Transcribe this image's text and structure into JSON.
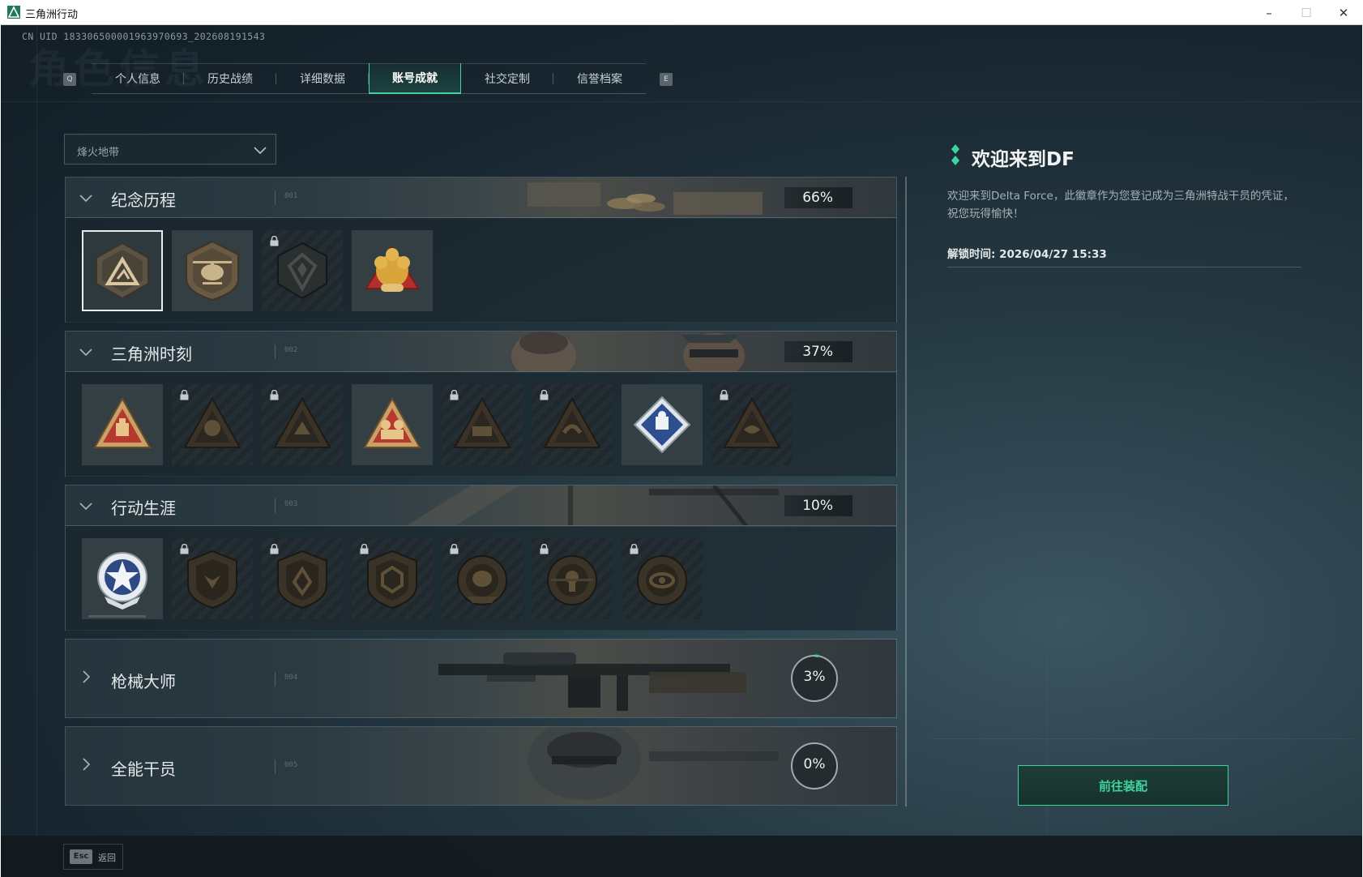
{
  "window": {
    "title": "三角洲行动",
    "minimize_label": "–",
    "maximize_label": "☐",
    "close_label": "✕"
  },
  "header": {
    "uid": "CN UID 183306500001963970693_202608191543",
    "bg_title": "角色信息"
  },
  "tabs": {
    "left_key": "Q",
    "right_key": "E",
    "items": [
      {
        "label": "个人信息",
        "active": false
      },
      {
        "label": "历史战绩",
        "active": false
      },
      {
        "label": "详细数据",
        "active": false
      },
      {
        "label": "账号成就",
        "active": true
      },
      {
        "label": "社交定制",
        "active": false
      },
      {
        "label": "信誉档案",
        "active": false
      }
    ]
  },
  "mode_select": {
    "value": "烽火地带"
  },
  "sections": [
    {
      "title": "纪念历程",
      "num": "001",
      "percent": "66%",
      "expanded": true,
      "badges": [
        {
          "icon": "delta-emblem-icon",
          "locked": false,
          "selected": true
        },
        {
          "icon": "helicopter-badge-icon",
          "locked": false
        },
        {
          "icon": "shield-mark-icon",
          "locked": true
        },
        {
          "icon": "gold-laurel-badge-icon",
          "locked": false
        }
      ]
    },
    {
      "title": "三角洲时刻",
      "num": "002",
      "percent": "37%",
      "expanded": true,
      "badges": [
        {
          "icon": "red-triangle-badge-icon",
          "locked": false
        },
        {
          "icon": "triangle-badge-icon",
          "locked": true
        },
        {
          "icon": "triangle-badge-icon",
          "locked": true
        },
        {
          "icon": "soldiers-triangle-badge-icon",
          "locked": false
        },
        {
          "icon": "triangle-badge-icon",
          "locked": true
        },
        {
          "icon": "triangle-badge-icon",
          "locked": true
        },
        {
          "icon": "diamond-badge-icon",
          "locked": false
        },
        {
          "icon": "triangle-badge-icon",
          "locked": true
        }
      ]
    },
    {
      "title": "行动生涯",
      "num": "003",
      "percent": "10%",
      "expanded": true,
      "badges": [
        {
          "icon": "star-emblem-icon",
          "locked": false,
          "progress": 0.85
        },
        {
          "icon": "shield-badge-icon",
          "locked": true
        },
        {
          "icon": "shield-badge-icon",
          "locked": true
        },
        {
          "icon": "shield-badge-icon",
          "locked": true
        },
        {
          "icon": "round-badge-icon",
          "locked": true
        },
        {
          "icon": "round-badge-icon",
          "locked": true
        },
        {
          "icon": "round-badge-icon",
          "locked": true
        }
      ]
    },
    {
      "title": "枪械大师",
      "num": "004",
      "percent": "3%",
      "ring_fraction": 0.03,
      "expanded": false
    },
    {
      "title": "全能干员",
      "num": "005",
      "percent": "0%",
      "ring_fraction": 0.0,
      "expanded": false
    }
  ],
  "detail": {
    "title": "欢迎来到DF",
    "description": "欢迎来到Delta Force，此徽章作为您登记成为三角洲特战干员的凭证，祝您玩得愉快！",
    "unlock_label": "解锁时间: 2026/04/27 15:33",
    "equip_button": "前往装配"
  },
  "footer": {
    "esc_key": "Esc",
    "esc_label": "返回"
  },
  "colors": {
    "accent": "#3fd39e",
    "panel": "#1c282f",
    "text": "#e4e9ea"
  }
}
